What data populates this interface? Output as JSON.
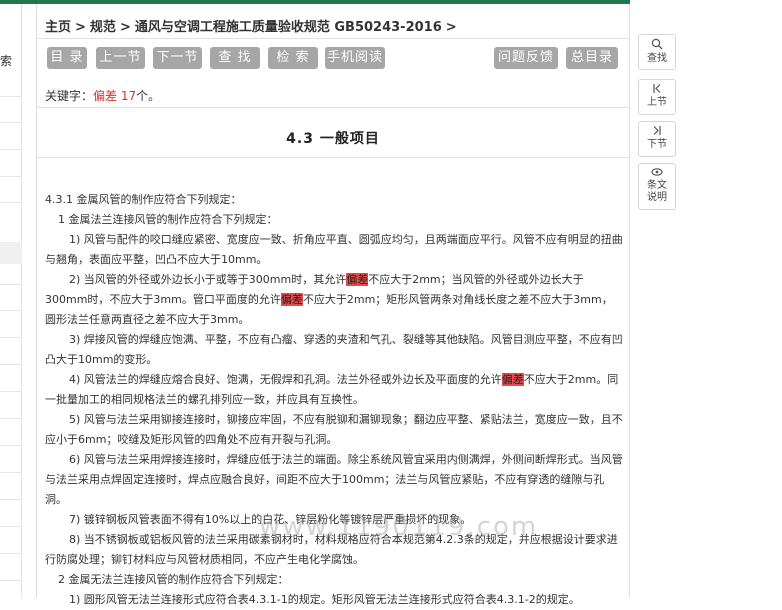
{
  "left": {
    "tab_fragment": "索"
  },
  "breadcrumb": {
    "home": "主页",
    "spec": "规范",
    "doc": "通风与空调工程施工质量验收规范 GB50243-2016",
    "sep": ">"
  },
  "toolbar": {
    "catalog": "目 录",
    "prev": "上一节",
    "next": "下一节",
    "find": "查 找",
    "search": "检 索",
    "mobile": "手机阅读",
    "feedback": "问题反馈",
    "all_catalog": "总目录"
  },
  "keyword": {
    "label": "关键字：",
    "term": "偏差",
    "count": "17",
    "suffix": "个。"
  },
  "section": {
    "title": "4.3  一般项目"
  },
  "content": {
    "p0": "4.3.1 金属风管的制作应符合下列规定：",
    "p1": "1 金属法兰连接风管的制作应符合下列规定：",
    "p2": "1) 风管与配件的咬口缝应紧密、宽度应一致、折角应平直、圆弧应均匀，且两端面应平行。风管不应有明显的扭曲与翘角，表面应平整，凹凸不应大于10mm。",
    "p3a": "2) 当风管的外径或外边长小于或等于300mm时，其允许",
    "p3h1": "偏差",
    "p3b": "不应大于2mm；当风管的外径或外边长大于300mm时，不应大于3mm。管口平面度的允许",
    "p3h2": "偏差",
    "p3c": "不应大于2mm；矩形风管两条对角线长度之差不应大于3mm，圆形法兰任意两直径之差不应大于3mm。",
    "p4": "3) 焊接风管的焊缝应饱满、平整，不应有凸瘤、穿透的夹渣和气孔、裂缝等其他缺陷。风管目测应平整，不应有凹凸大于10mm的变形。",
    "p5a": "4) 风管法兰的焊缝应熔合良好、饱满，无假焊和孔洞。法兰外径或外边长及平面度的允许",
    "p5h": "偏差",
    "p5b": "不应大于2mm。同一批量加工的相同规格法兰的螺孔排列应一致，并应具有互换性。",
    "p6": "5) 风管与法兰采用铆接连接时，铆接应牢固，不应有脱铆和漏铆现象；翻边应平整、紧贴法兰，宽度应一致，且不应小于6mm；咬缝及矩形风管的四角处不应有开裂与孔洞。",
    "p7": "6) 风管与法兰采用焊接连接时，焊缝应低于法兰的端面。除尘系统风管宜采用内侧满焊，外侧间断焊形式。当风管与法兰采用点焊固定连接时，焊点应融合良好，间距不应大于100mm；法兰与风管应紧贴，不应有穿透的缝隙与孔洞。",
    "p8": "7) 镀锌钢板风管表面不得有10%以上的白花、锌层粉化等镀锌层严重损坏的现象。",
    "p9": "8) 当不锈钢板或铝板风管的法兰采用碳素钢材时，材料规格应符合本规范第4.2.3条的规定，并应根据设计要求进行防腐处理；铆钉材料应与风管材质相同，不应产生电化学腐蚀。",
    "p10": "2 金属无法兰连接风管的制作应符合下列规定：",
    "p11": "1) 圆形风管无法兰连接形式应符合表4.3.1-1的规定。矩形风管无法兰连接形式应符合表4.3.1-2的规定。"
  },
  "watermark": "www.1190119.com",
  "side_tools": {
    "find": {
      "icon": "search-icon",
      "label": "查找"
    },
    "prev": {
      "icon": "prev-icon",
      "label": "上节"
    },
    "next": {
      "icon": "next-icon",
      "label": "下节"
    },
    "desc": {
      "icon": "eye-icon",
      "label1": "条文",
      "label2": "说明"
    }
  },
  "colors": {
    "accent_bar": "#1e7a4c",
    "button_bg": "#a6a6a6",
    "highlight": "#e84a4a",
    "keyword_red": "#d9322c"
  }
}
